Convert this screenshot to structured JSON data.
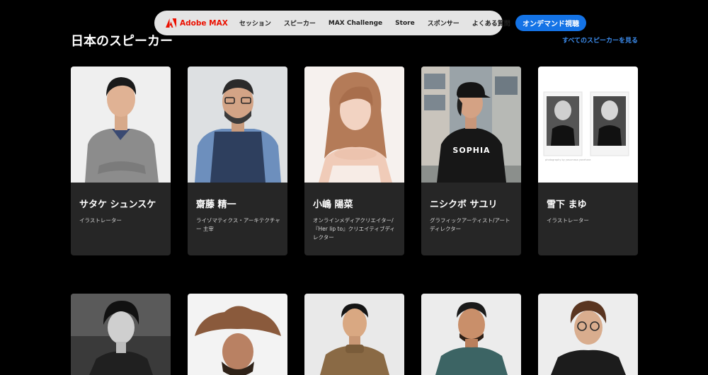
{
  "nav": {
    "brand": "Adobe MAX",
    "items": [
      {
        "label": "セッション"
      },
      {
        "label": "スピーカー"
      },
      {
        "label": "MAX Challenge"
      },
      {
        "label": "Store"
      },
      {
        "label": "スポンサー"
      },
      {
        "label": "よくある質問"
      }
    ],
    "cta": "オンデマンド視聴"
  },
  "section": {
    "title": "日本のスピーカー",
    "see_all": "すべてのスピーカーを見る"
  },
  "speakers": [
    {
      "name": "サタケ シュンスケ",
      "role": "イラストレーター"
    },
    {
      "name": "齋藤 精一",
      "role": "ライゾマティクス・アーキテクチャー 主宰"
    },
    {
      "name": "小嶋 陽菜",
      "role": "オンラインメディアクリエイター/『Her lip to』クリエイティブディレクター"
    },
    {
      "name": "ニシクボ サユリ",
      "role": "グラフィックアーティスト/アートディレクター"
    },
    {
      "name": "雪下 まゆ",
      "role": "イラストレーター"
    }
  ],
  "photo_text": {
    "shirt": "SOPHIA",
    "polaroid_caption": "photography by yasumasa yonehara"
  }
}
